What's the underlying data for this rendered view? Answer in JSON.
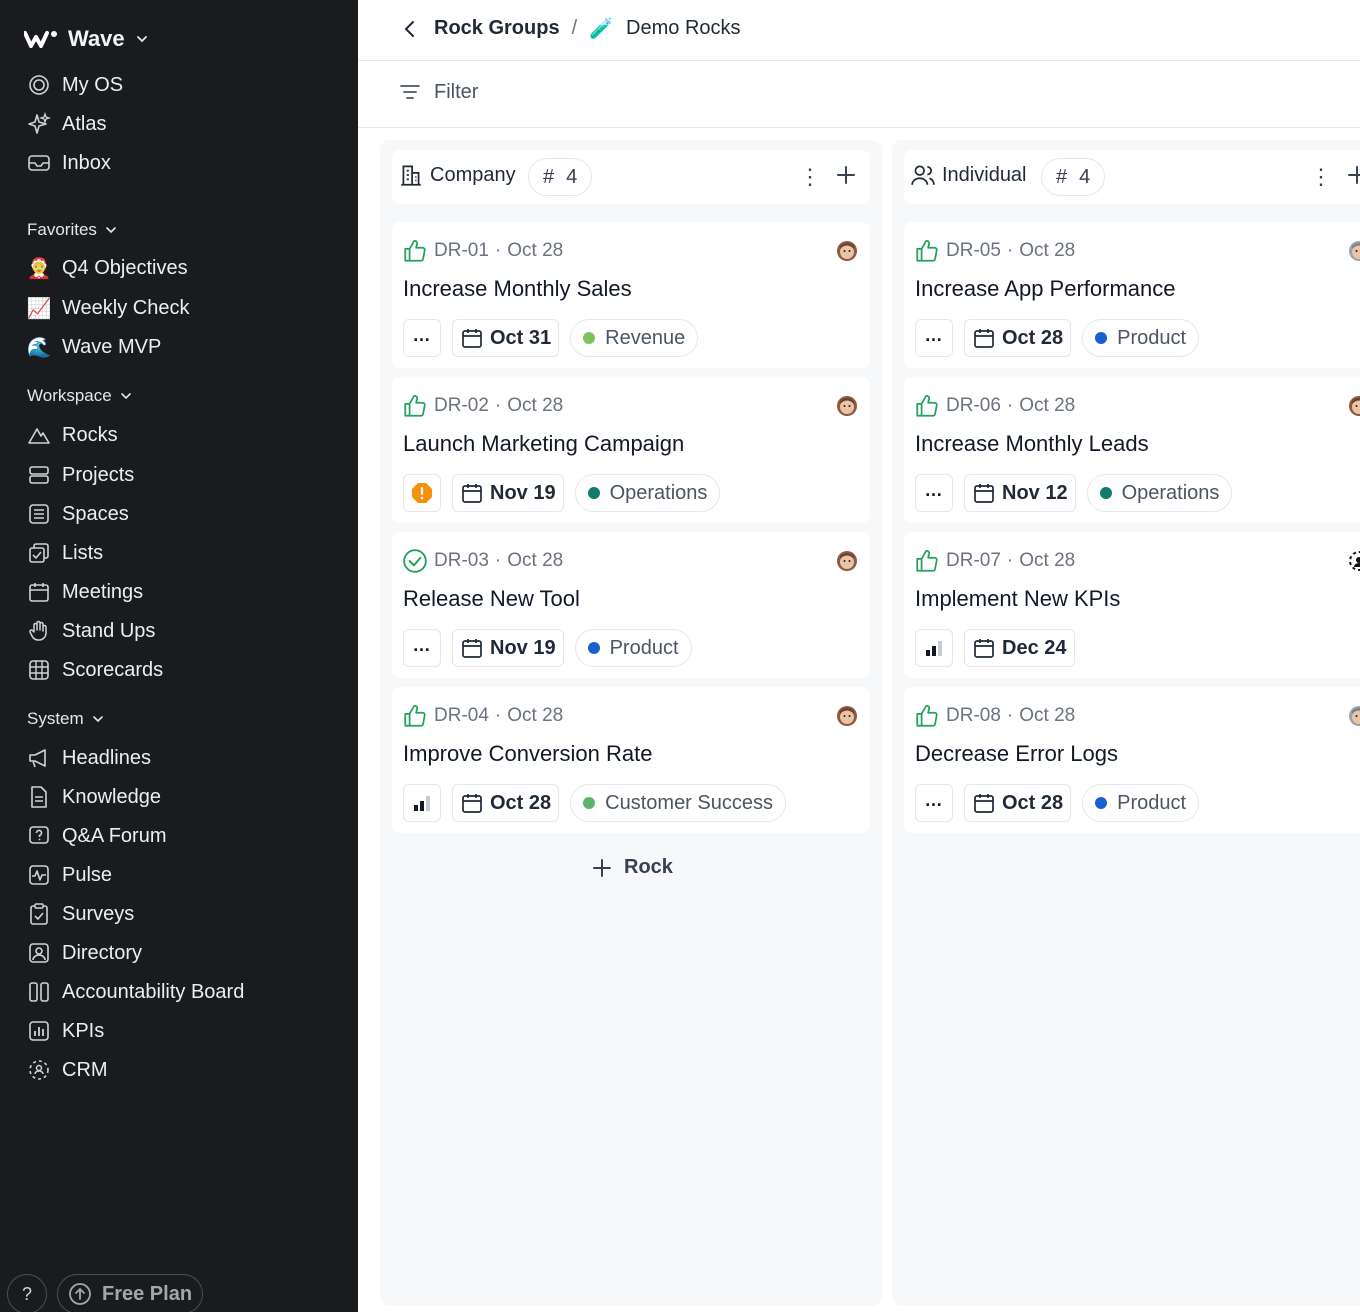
{
  "sidebar": {
    "workspace_name": "Wave",
    "nav_top": [
      {
        "label": "My OS",
        "icon": "target-icon"
      },
      {
        "label": "Atlas",
        "icon": "sparkle-icon"
      },
      {
        "label": "Inbox",
        "icon": "inbox-icon"
      }
    ],
    "favorites_label": "Favorites",
    "favorites": [
      {
        "label": "Q4 Objectives",
        "emoji": "🤶"
      },
      {
        "label": "Weekly Check",
        "emoji": "📈"
      },
      {
        "label": "Wave MVP",
        "emoji": "🌊"
      }
    ],
    "workspace_label": "Workspace",
    "workspace_items": [
      {
        "label": "Rocks",
        "icon": "mountain-icon"
      },
      {
        "label": "Projects",
        "icon": "projects-icon"
      },
      {
        "label": "Spaces",
        "icon": "spaces-icon"
      },
      {
        "label": "Lists",
        "icon": "lists-icon"
      },
      {
        "label": "Meetings",
        "icon": "calendar-icon"
      },
      {
        "label": "Stand Ups",
        "icon": "hand-icon"
      },
      {
        "label": "Scorecards",
        "icon": "grid-icon"
      }
    ],
    "system_label": "System",
    "system_items": [
      {
        "label": "Headlines",
        "icon": "megaphone-icon"
      },
      {
        "label": "Knowledge",
        "icon": "document-icon"
      },
      {
        "label": "Q&A Forum",
        "icon": "question-bubble-icon"
      },
      {
        "label": "Pulse",
        "icon": "pulse-icon"
      },
      {
        "label": "Surveys",
        "icon": "clipboard-check-icon"
      },
      {
        "label": "Directory",
        "icon": "contact-icon"
      },
      {
        "label": "Accountability Board",
        "icon": "columns-icon"
      },
      {
        "label": "KPIs",
        "icon": "bar-chart-icon"
      },
      {
        "label": "CRM",
        "icon": "crm-icon"
      }
    ],
    "help_label": "?",
    "plan_label": "Free Plan"
  },
  "breadcrumb": {
    "parent": "Rock Groups",
    "separator": "/",
    "current": "Demo Rocks",
    "current_emoji": "🧪"
  },
  "toolbar": {
    "filter_label": "Filter"
  },
  "columns": [
    {
      "title": "Company",
      "count_symbol": "#",
      "count": "4",
      "add_rock_label": "Rock",
      "cards": [
        {
          "id": "DR-01",
          "sep": "·",
          "date": "Oct 28",
          "title": "Increase Monthly Sales",
          "status": "thumbs-up",
          "first_chip": "more",
          "due": "Oct 31",
          "tag": "Revenue",
          "tag_color": "#7cc35b"
        },
        {
          "id": "DR-02",
          "sep": "·",
          "date": "Oct 28",
          "title": "Launch Marketing Campaign",
          "status": "thumbs-up",
          "first_chip": "warning",
          "due": "Nov 19",
          "tag": "Operations",
          "tag_color": "#0f7b6c"
        },
        {
          "id": "DR-03",
          "sep": "·",
          "date": "Oct 28",
          "title": "Release New Tool",
          "status": "check-circle",
          "first_chip": "more",
          "due": "Nov 19",
          "tag": "Product",
          "tag_color": "#1a5fd1"
        },
        {
          "id": "DR-04",
          "sep": "·",
          "date": "Oct 28",
          "title": "Improve Conversion Rate",
          "status": "thumbs-up",
          "first_chip": "bars",
          "due": "Oct 28",
          "tag": "Customer Success",
          "tag_color": "#5fb36e"
        }
      ]
    },
    {
      "title": "Individual",
      "count_symbol": "#",
      "count": "4",
      "cards": [
        {
          "id": "DR-05",
          "sep": "·",
          "date": "Oct 28",
          "title": "Increase App Performance",
          "status": "thumbs-up",
          "first_chip": "more",
          "due": "Oct 28",
          "tag": "Product",
          "tag_color": "#1a5fd1"
        },
        {
          "id": "DR-06",
          "sep": "·",
          "date": "Oct 28",
          "title": "Increase Monthly Leads",
          "status": "thumbs-up",
          "first_chip": "more",
          "due": "Nov 12",
          "tag": "Operations",
          "tag_color": "#0f7b6c"
        },
        {
          "id": "DR-07",
          "sep": "·",
          "date": "Oct 28",
          "title": "Implement New KPIs",
          "status": "thumbs-up",
          "first_chip": "bars",
          "due": "Dec 24",
          "tag": "",
          "tag_color": ""
        },
        {
          "id": "DR-08",
          "sep": "·",
          "date": "Oct 28",
          "title": "Decrease Error Logs",
          "status": "thumbs-up",
          "first_chip": "more",
          "due": "Oct 28",
          "tag": "Product",
          "tag_color": "#1a5fd1"
        }
      ]
    }
  ],
  "colors": {
    "sidebar_bg": "#1a1b1e",
    "board_bg": "#f7f8fa",
    "status_green": "#22a05a",
    "warning_orange": "#f5900b"
  }
}
